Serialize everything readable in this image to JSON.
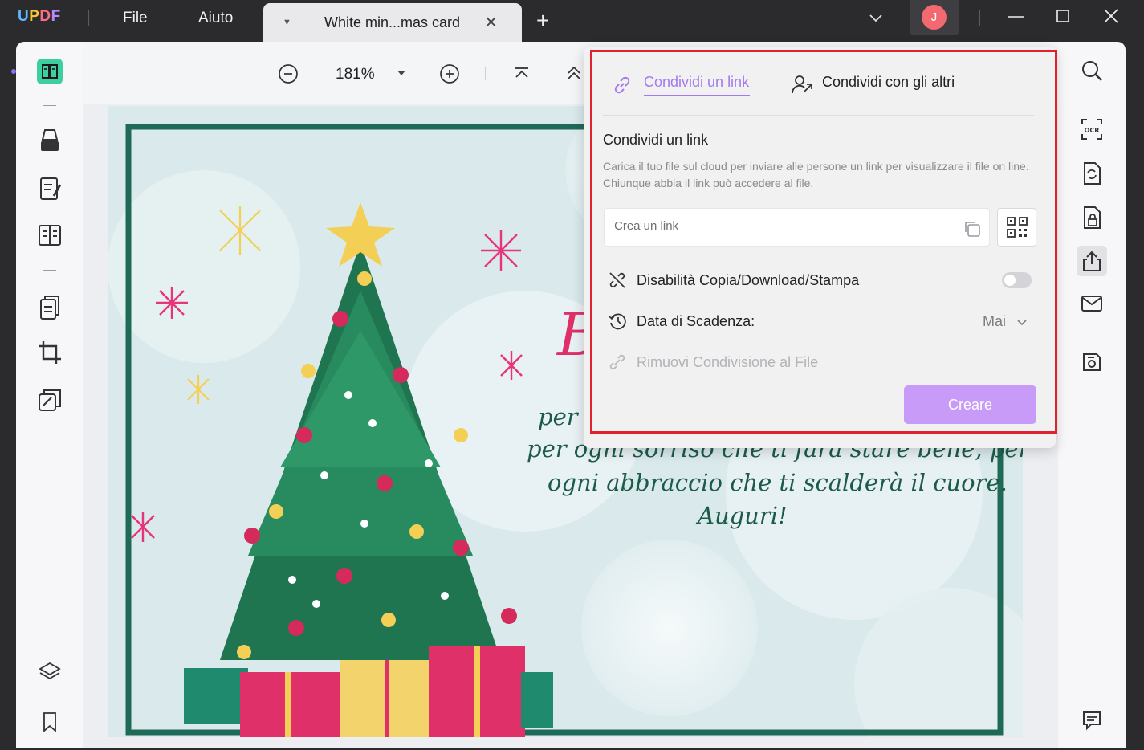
{
  "app": {
    "logo": {
      "u": "U",
      "p": "P",
      "d": "D",
      "f": "F"
    },
    "menu": {
      "file": "File",
      "help": "Aiuto"
    },
    "tab_title": "White min...mas card",
    "tab_close": "×",
    "new_tab": "+",
    "avatar_initial": "J"
  },
  "toolbar": {
    "zoom_level": "181%"
  },
  "card": {
    "line1": "per o",
    "line2": "per ogni sorriso che ti farà stare bene, per",
    "line3": "ogni abbraccio che ti scalderà il cuore.",
    "line4": "Auguri!"
  },
  "share": {
    "tabs": {
      "link": "Condividi un link",
      "others": "Condividi con gli altri"
    },
    "section_title": "Condividi un link",
    "description": "Carica il tuo file sul cloud per inviare alle persone un link per visualizzare il file on line. Chiunque abbia il link può accedere al file.",
    "link_placeholder": "Crea un link",
    "disable_label": "Disabilità Copia/Download/Stampa",
    "disable_enabled": false,
    "expiry_label": "Data di Scadenza:",
    "expiry_value": "Mai",
    "remove_label": "Rimuovi Condivisione al File",
    "create_button": "Creare"
  },
  "colors": {
    "accent": "#a57af0",
    "button": "#c79bf7",
    "highlight": "#e0212e",
    "card_green": "#1c5b49"
  }
}
